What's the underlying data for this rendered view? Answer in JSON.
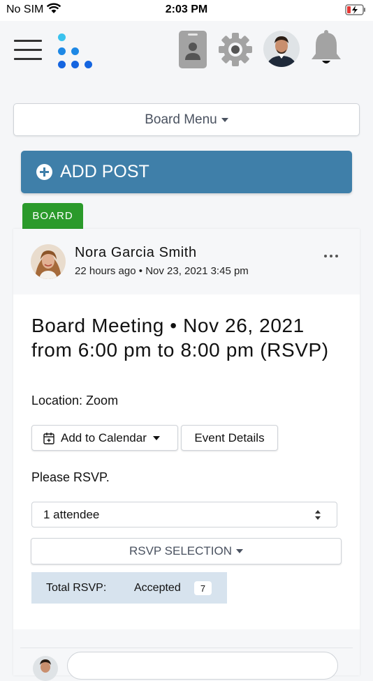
{
  "status_bar": {
    "carrier": "No SIM",
    "time": "2:03 PM"
  },
  "top_bar": {
    "logo_colors": [
      "#3ac2ee",
      "#1e88e5",
      "#1565e0"
    ],
    "icons": [
      "menu-icon",
      "id-badge-icon",
      "gear-icon",
      "user-avatar",
      "bell-icon"
    ]
  },
  "board_menu": {
    "label": "Board Menu"
  },
  "add_post": {
    "label": "ADD POST"
  },
  "badge": {
    "label": "BOARD"
  },
  "post": {
    "author": "Nora Garcia Smith",
    "relative_time": "22 hours ago",
    "separator": "•",
    "timestamp": "Nov 23, 2021 3:45 pm",
    "title": "Board Meeting • Nov 26, 2021 from 6:00 pm to 8:00 pm (RSVP)",
    "location": "Location: Zoom",
    "add_to_calendar": "Add to Calendar",
    "event_details": "Event Details",
    "please_rsvp": "Please RSVP.",
    "attendee_select_value": "1 attendee",
    "rsvp_selection": "RSVP SELECTION",
    "total_rsvp_label": "Total RSVP:",
    "accepted_label": "Accepted",
    "accepted_count": "7"
  },
  "colors": {
    "add_post_bg": "#3f7fa9",
    "board_badge_bg": "#2b9a2b",
    "rsvp_summary_bg": "#d7e3ee"
  }
}
